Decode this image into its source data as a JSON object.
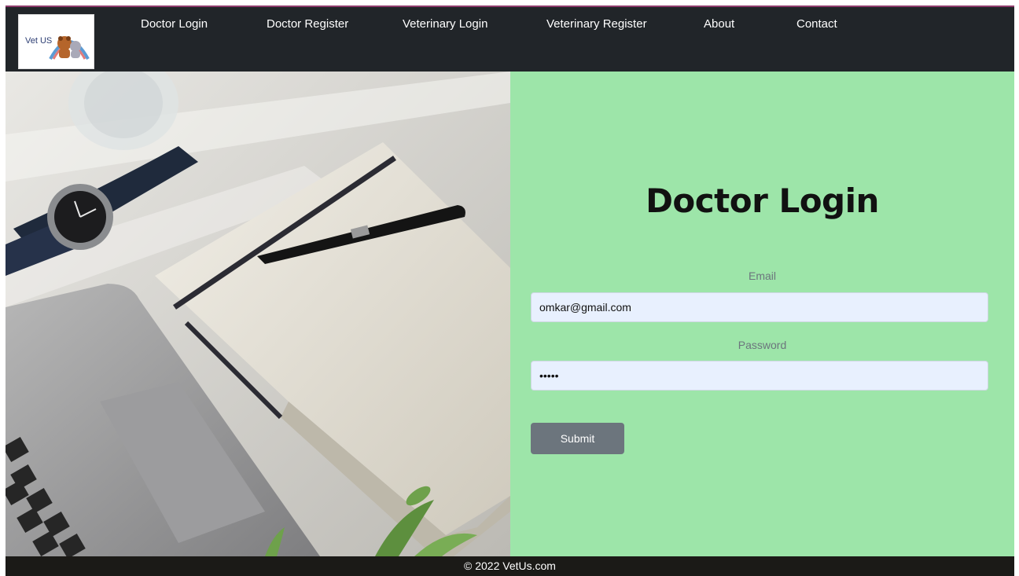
{
  "brand": {
    "logo_text": "Vet US"
  },
  "nav": {
    "items": [
      {
        "label": "Doctor Login"
      },
      {
        "label": "Doctor Register"
      },
      {
        "label": "Veterinary Login"
      },
      {
        "label": "Veterinary Register"
      },
      {
        "label": "About"
      },
      {
        "label": "Contact"
      }
    ]
  },
  "form": {
    "title": "Doctor Login",
    "email_label": "Email",
    "email_value": "omkar@gmail.com",
    "password_label": "Password",
    "password_value": "omkar",
    "submit_label": "Submit"
  },
  "footer": {
    "text": "© 2022 VetUs.com"
  },
  "colors": {
    "navbar": "#212529",
    "panel": "#9de5a9",
    "input_bg": "#e8f0fe",
    "button": "#6c757d",
    "footer": "#1b1a17"
  }
}
